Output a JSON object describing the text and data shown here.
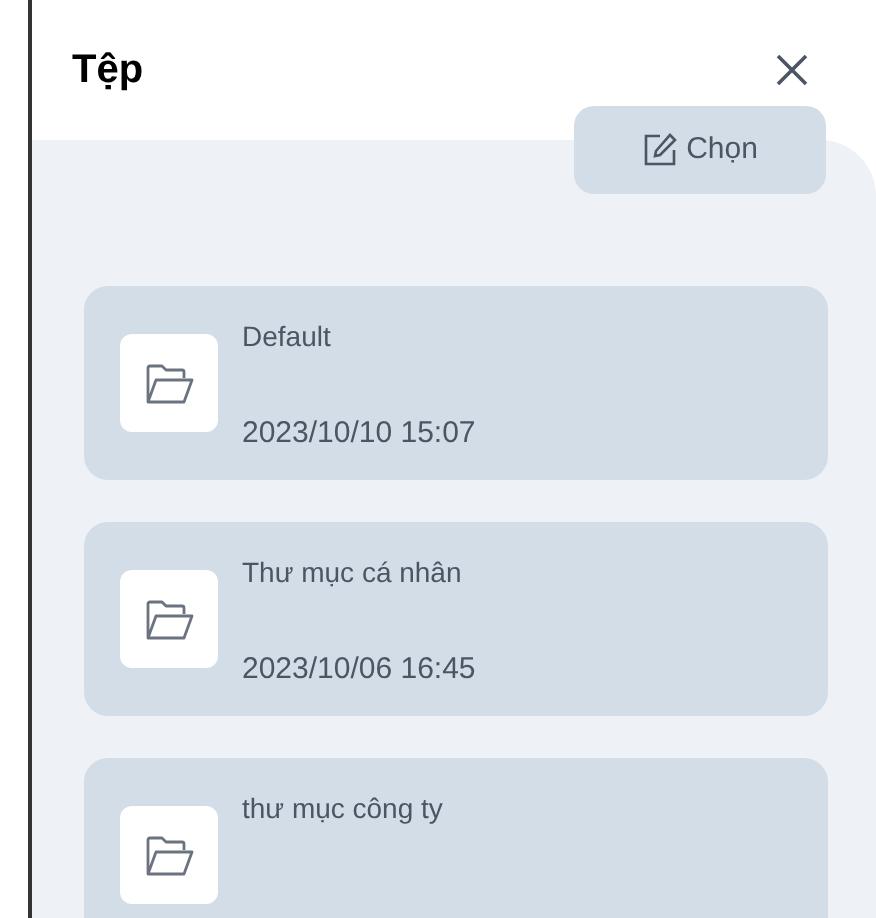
{
  "title": "Tệp",
  "select_button": {
    "label": "Chọn"
  },
  "folders": [
    {
      "name": "Default",
      "date": "2023/10/10 15:07"
    },
    {
      "name": "Thư mục cá nhân",
      "date": "2023/10/06 16:45"
    },
    {
      "name": "thư mục công ty"
    }
  ]
}
